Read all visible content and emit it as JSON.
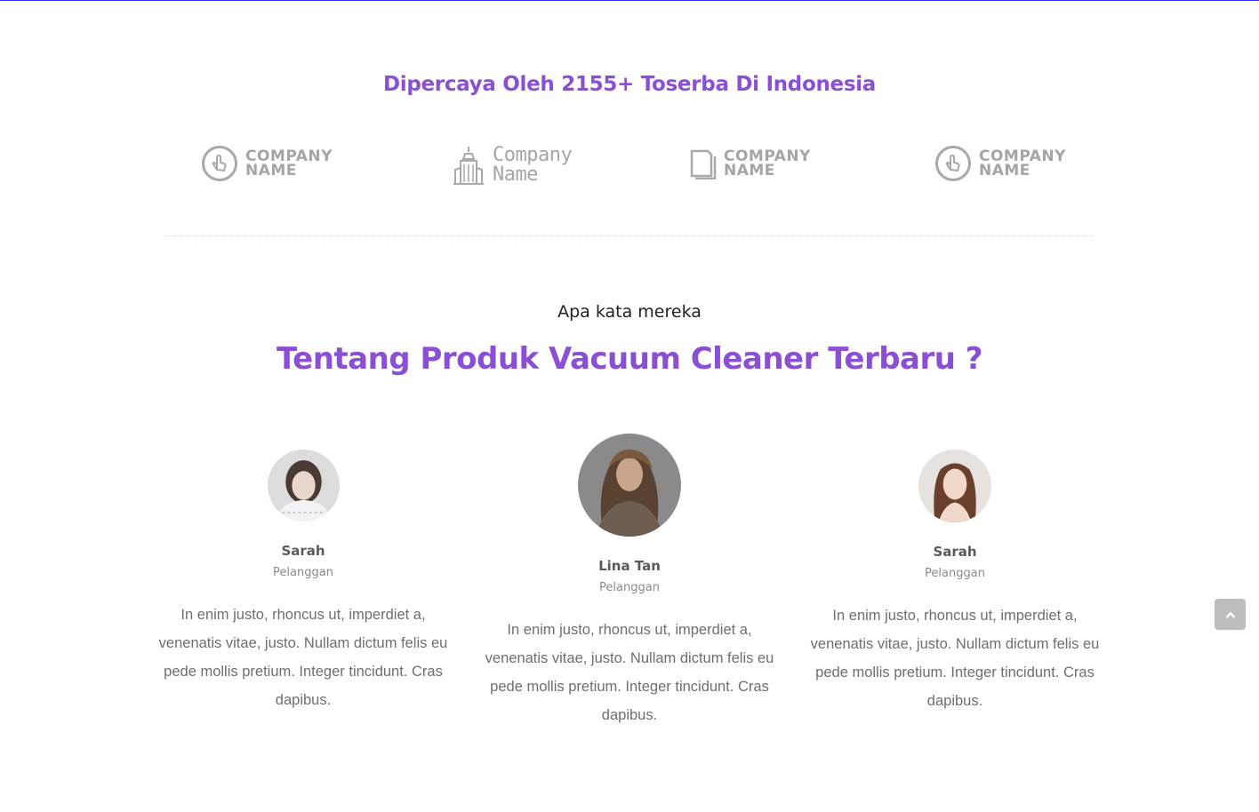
{
  "trusted": {
    "heading": "Dipercaya Oleh 2155+ Toserba Di Indonesia",
    "logos": [
      {
        "icon": "pointer-hand-icon",
        "line1": "COMPANY",
        "line2": "NAME"
      },
      {
        "icon": "building-icon",
        "line1": "Company",
        "line2": "Name"
      },
      {
        "icon": "document-stack-icon",
        "line1": "COMPANY",
        "line2": "NAME"
      },
      {
        "icon": "pointer-hand-icon",
        "line1": "COMPANY",
        "line2": "NAME"
      }
    ]
  },
  "testimonials_section": {
    "kicker": "Apa kata mereka",
    "title": "Tentang Produk Vacuum Cleaner Terbaru ?",
    "items": [
      {
        "name": "Sarah",
        "role": "Pelanggan",
        "text": "In enim justo, rhoncus ut, imperdiet a, venenatis vitae, justo. Nullam dictum felis eu pede mollis pretium. Integer tincidunt. Cras dapibus."
      },
      {
        "name": "Lina Tan",
        "role": "Pelanggan",
        "text": "In enim justo, rhoncus ut, imperdiet a, venenatis vitae, justo. Nullam dictum felis eu pede mollis pretium. Integer tincidunt. Cras dapibus."
      },
      {
        "name": "Sarah",
        "role": "Pelanggan",
        "text": "In enim justo, rhoncus ut, imperdiet a, venenatis vitae, justo. Nullam dictum felis eu pede mollis pretium. Integer tincidunt. Cras dapibus."
      }
    ]
  },
  "scroll_top": {
    "icon": "chevron-up-icon"
  },
  "colors": {
    "accent": "#8a4fd4",
    "logo_gray": "#a5a5a5",
    "body_text": "#6e6e6e"
  }
}
